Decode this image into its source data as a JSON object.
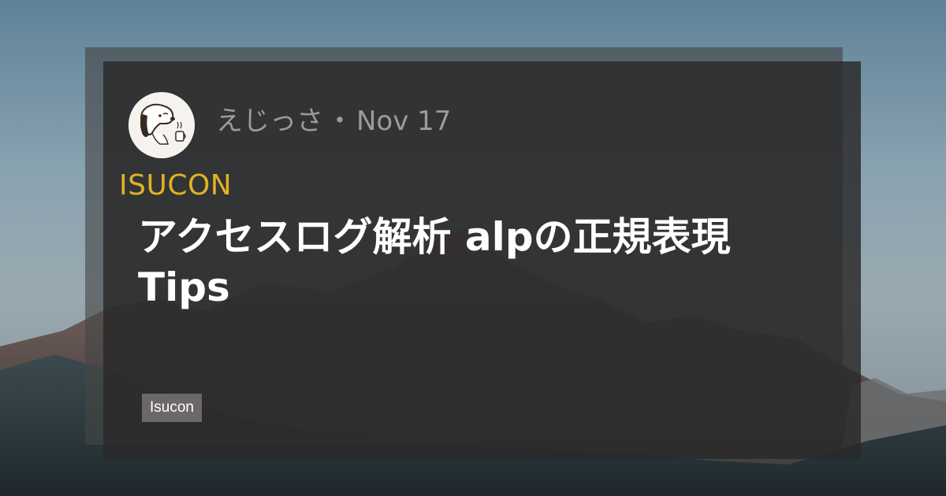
{
  "post": {
    "author": "えじっさ",
    "separator": "・",
    "date": "Nov 17",
    "category": "ISUCON",
    "title": "アクセスログ解析 alpの正規表現\nTips",
    "tags": [
      "Isucon"
    ]
  },
  "colors": {
    "category": "#e0b222",
    "title": "#ffffff",
    "meta": "#9b9b9b",
    "tag_bg": "#6c6867",
    "card_front": "#2a2828",
    "card_back": "#464646"
  },
  "icons": {
    "avatar": "snoopy-coffee-avatar-icon"
  }
}
